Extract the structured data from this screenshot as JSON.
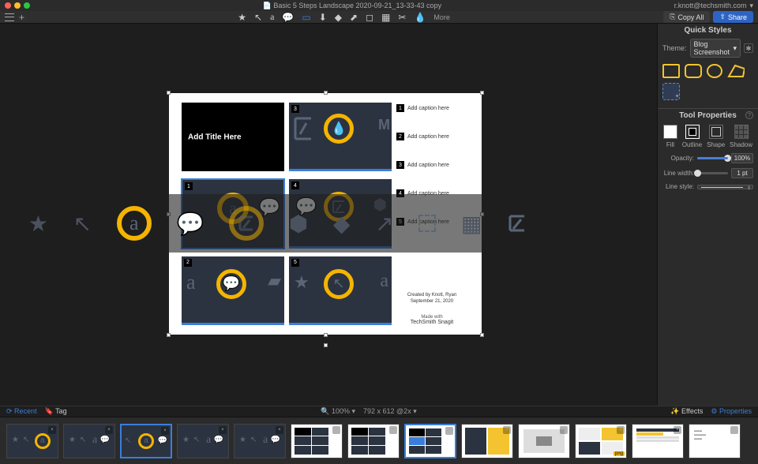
{
  "titlebar": {
    "filename": "Basic 5 Steps Landscape 2020-09-21_13-33-43 copy",
    "account": "r.knott@techsmith.com"
  },
  "toolbar": {
    "more": "More",
    "copy_all": "Copy All",
    "share": "Share"
  },
  "quick_styles": {
    "title": "Quick Styles",
    "theme_label": "Theme:",
    "theme_value": "Blog Screenshot"
  },
  "tool_props": {
    "title": "Tool Properties",
    "fill": "Fill",
    "outline": "Outline",
    "shape": "Shape",
    "shadow": "Shadow",
    "opacity_label": "Opacity:",
    "opacity_value": "100%",
    "linewidth_label": "Line width:",
    "linewidth_value": "1 pt",
    "linestyle_label": "Line style:"
  },
  "doc": {
    "title_tile": "Add Title Here",
    "cap1": "Add caption here",
    "cap2": "Add caption here",
    "cap3": "Add caption here",
    "cap4": "Add caption here",
    "cap5": "Add caption here",
    "credit_line1": "Created by Knott, Ryan",
    "credit_line2": "September 21, 2020",
    "madewith": "Made with",
    "brand": "TechSmith Snagit"
  },
  "status": {
    "recent": "Recent",
    "tag": "Tag",
    "zoom": "100%",
    "dims": "792 x 612 @2x",
    "effects": "Effects",
    "properties": "Properties"
  },
  "tray": {
    "png": "png"
  },
  "icons": {
    "search": "🔍",
    "chevron": "▾"
  }
}
